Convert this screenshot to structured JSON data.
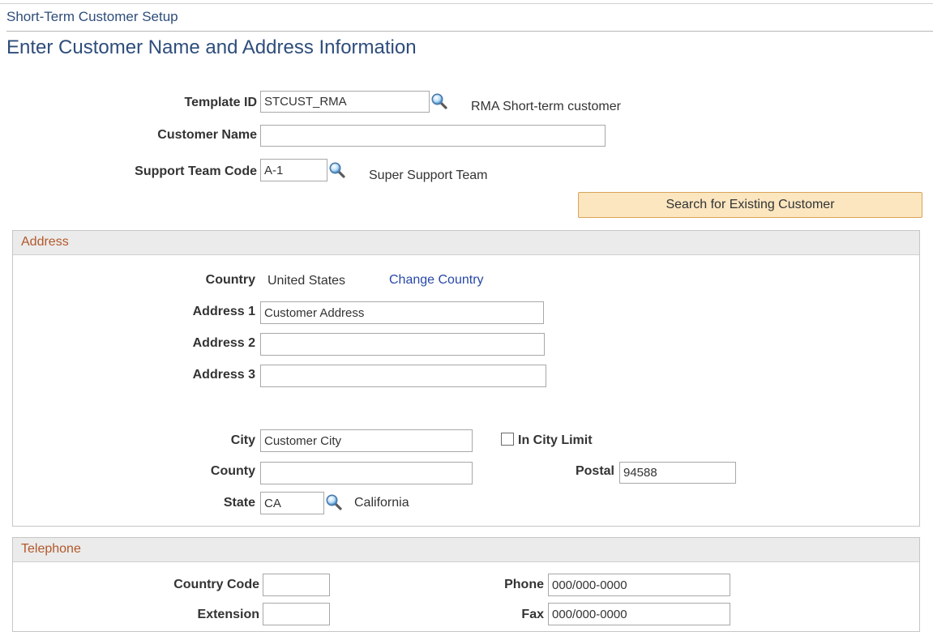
{
  "breadcrumb": "Short-Term Customer Setup",
  "page_title": "Enter Customer Name and Address Information",
  "header_fields": {
    "template_id": {
      "label": "Template ID",
      "value": "STCUST_RMA",
      "description": "RMA Short-term customer"
    },
    "customer_name": {
      "label": "Customer Name",
      "value": ""
    },
    "support_team_code": {
      "label": "Support Team Code",
      "value": "A-1",
      "description": "Super Support Team"
    }
  },
  "search_button_label": "Search for Existing Customer",
  "address": {
    "title": "Address",
    "country_label": "Country",
    "country_value": "United States",
    "change_country_link": "Change Country",
    "address1": {
      "label": "Address 1",
      "value": "Customer Address"
    },
    "address2": {
      "label": "Address 2",
      "value": ""
    },
    "address3": {
      "label": "Address 3",
      "value": ""
    },
    "city": {
      "label": "City",
      "value": "Customer City"
    },
    "in_city_limit": {
      "label": "In City Limit",
      "checked": false
    },
    "county": {
      "label": "County",
      "value": ""
    },
    "postal": {
      "label": "Postal",
      "value": "94588"
    },
    "state": {
      "label": "State",
      "value": "CA",
      "description": "California"
    }
  },
  "telephone": {
    "title": "Telephone",
    "country_code": {
      "label": "Country Code",
      "value": ""
    },
    "phone": {
      "label": "Phone",
      "value": "000/000-0000"
    },
    "extension": {
      "label": "Extension",
      "value": ""
    },
    "fax": {
      "label": "Fax",
      "value": "000/000-0000"
    }
  },
  "colors": {
    "title_blue": "#2e4d7b",
    "group_title_orange": "#b2582a",
    "link_blue": "#2848a8",
    "button_fill": "#fbe6c0",
    "button_border": "#d8a45a"
  },
  "icons": {
    "lookup": "magnifying-glass-icon"
  }
}
